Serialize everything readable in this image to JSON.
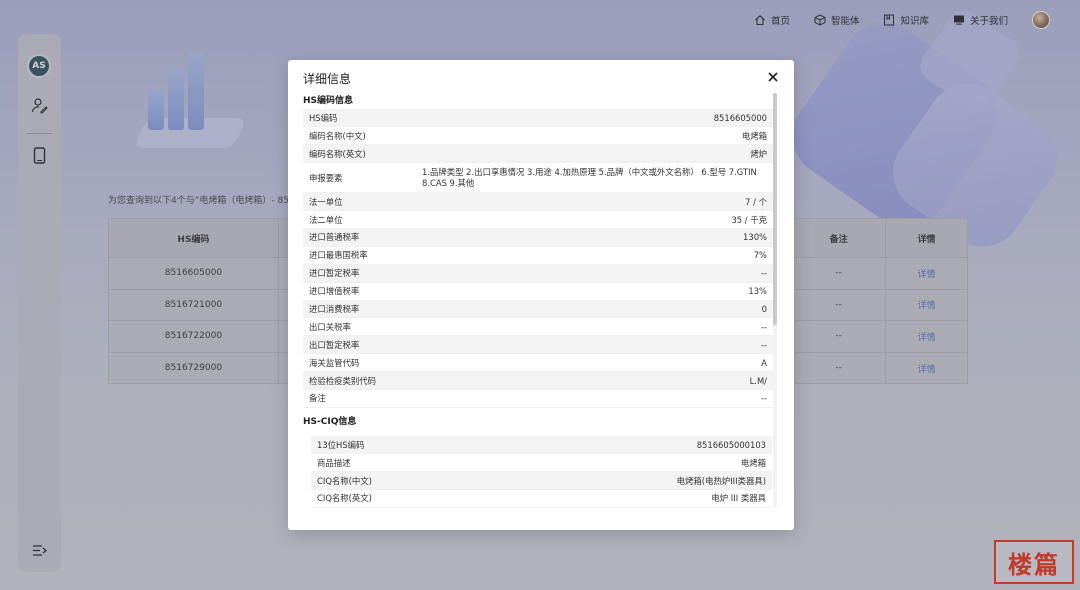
{
  "nav": {
    "items": [
      {
        "label": "首页",
        "icon": "home-icon"
      },
      {
        "label": "智能体",
        "icon": "cube-icon"
      },
      {
        "label": "知识库",
        "icon": "book-icon"
      },
      {
        "label": "关于我们",
        "icon": "monitor-icon"
      }
    ]
  },
  "sidebar": {
    "logo_text": "AS",
    "items": [
      "user-edit-icon",
      "phone-icon"
    ],
    "collapse_icon": "menu-collapse-icon"
  },
  "main": {
    "result_text": "为您查询到以下4个与“电烤箱（电烤箱）- 85",
    "table": {
      "headers": [
        "HS编码",
        "备注",
        "详情"
      ],
      "rows": [
        {
          "code": "8516605000",
          "note": "--",
          "detail": "详情"
        },
        {
          "code": "8516721000",
          "note": "--",
          "detail": "详情"
        },
        {
          "code": "8516722000",
          "note": "--",
          "detail": "详情"
        },
        {
          "code": "8516729000",
          "note": "--",
          "detail": "详情"
        }
      ]
    }
  },
  "modal": {
    "title": "详细信息",
    "hs_section_title": "HS编码信息",
    "hs_rows": [
      {
        "k": "HS编码",
        "v": "8516605000"
      },
      {
        "k": "编码名称(中文)",
        "v": "电烤箱"
      },
      {
        "k": "编码名称(英文)",
        "v": "烤炉"
      },
      {
        "k": "申报要素",
        "v": "1.品牌类型 2.出口享惠情况 3.用途 4.加热原理 5.品牌（中文或外文名称） 6.型号 7.GTIN 8.CAS 9.其他"
      },
      {
        "k": "法一单位",
        "v": "7 / 个"
      },
      {
        "k": "法二单位",
        "v": "35 / 千克"
      },
      {
        "k": "进口普通税率",
        "v": "130%"
      },
      {
        "k": "进口最惠国税率",
        "v": "7%"
      },
      {
        "k": "进口暂定税率",
        "v": "--"
      },
      {
        "k": "进口增值税率",
        "v": "13%"
      },
      {
        "k": "进口消费税率",
        "v": "0"
      },
      {
        "k": "出口关税率",
        "v": "--"
      },
      {
        "k": "出口暂定税率",
        "v": "--"
      },
      {
        "k": "海关监管代码",
        "v": "A"
      },
      {
        "k": "检验检疫类别代码",
        "v": "L.M/"
      },
      {
        "k": "备注",
        "v": "--"
      }
    ],
    "ciq_section_title": "HS-CIQ信息",
    "ciq_rows": [
      {
        "k": "13位HS编码",
        "v": "8516605000103"
      },
      {
        "k": "商品描述",
        "v": "电烤箱"
      },
      {
        "k": "CIQ名称(中文)",
        "v": "电烤箱(电热炉III类器具)"
      },
      {
        "k": "CIQ名称(英文)",
        "v": "电炉 III 类器具"
      }
    ]
  },
  "watermark": {
    "text": "楼篇"
  }
}
